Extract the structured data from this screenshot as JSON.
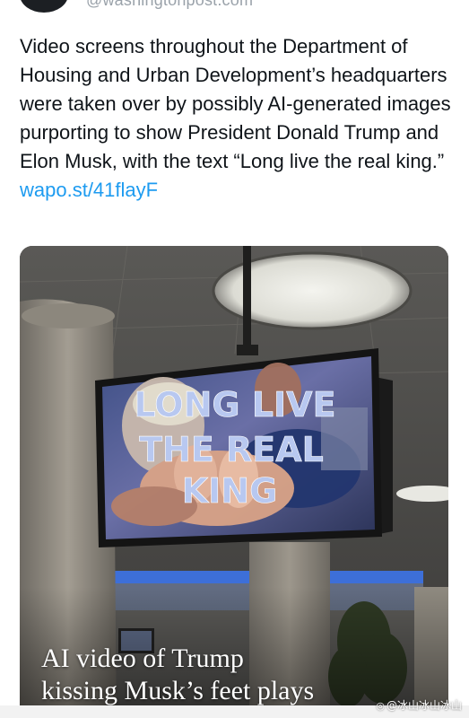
{
  "header": {
    "handle": "@washingtonpost.com"
  },
  "tweet": {
    "text": "Video screens throughout the Department of Housing and Urban Development’s headquarters were taken over by possibly AI-generated images purporting to show President Donald Trump and Elon Musk, with the text “Long live the real king.” ",
    "link_text": "wapo.st/41flayF"
  },
  "media": {
    "screen_line_1": "LONG LIVE",
    "screen_line_2": "THE REAL",
    "screen_line_3": "KING",
    "headline_line_1": "AI video of Trump",
    "headline_line_2": "kissing Musk’s feet plays"
  },
  "watermark": {
    "text": "@冰山冰山冰山",
    "icon": "weibo-icon"
  },
  "colors": {
    "link": "#1d9bf0",
    "text": "#0f1419",
    "handle": "#9aa2aa"
  }
}
